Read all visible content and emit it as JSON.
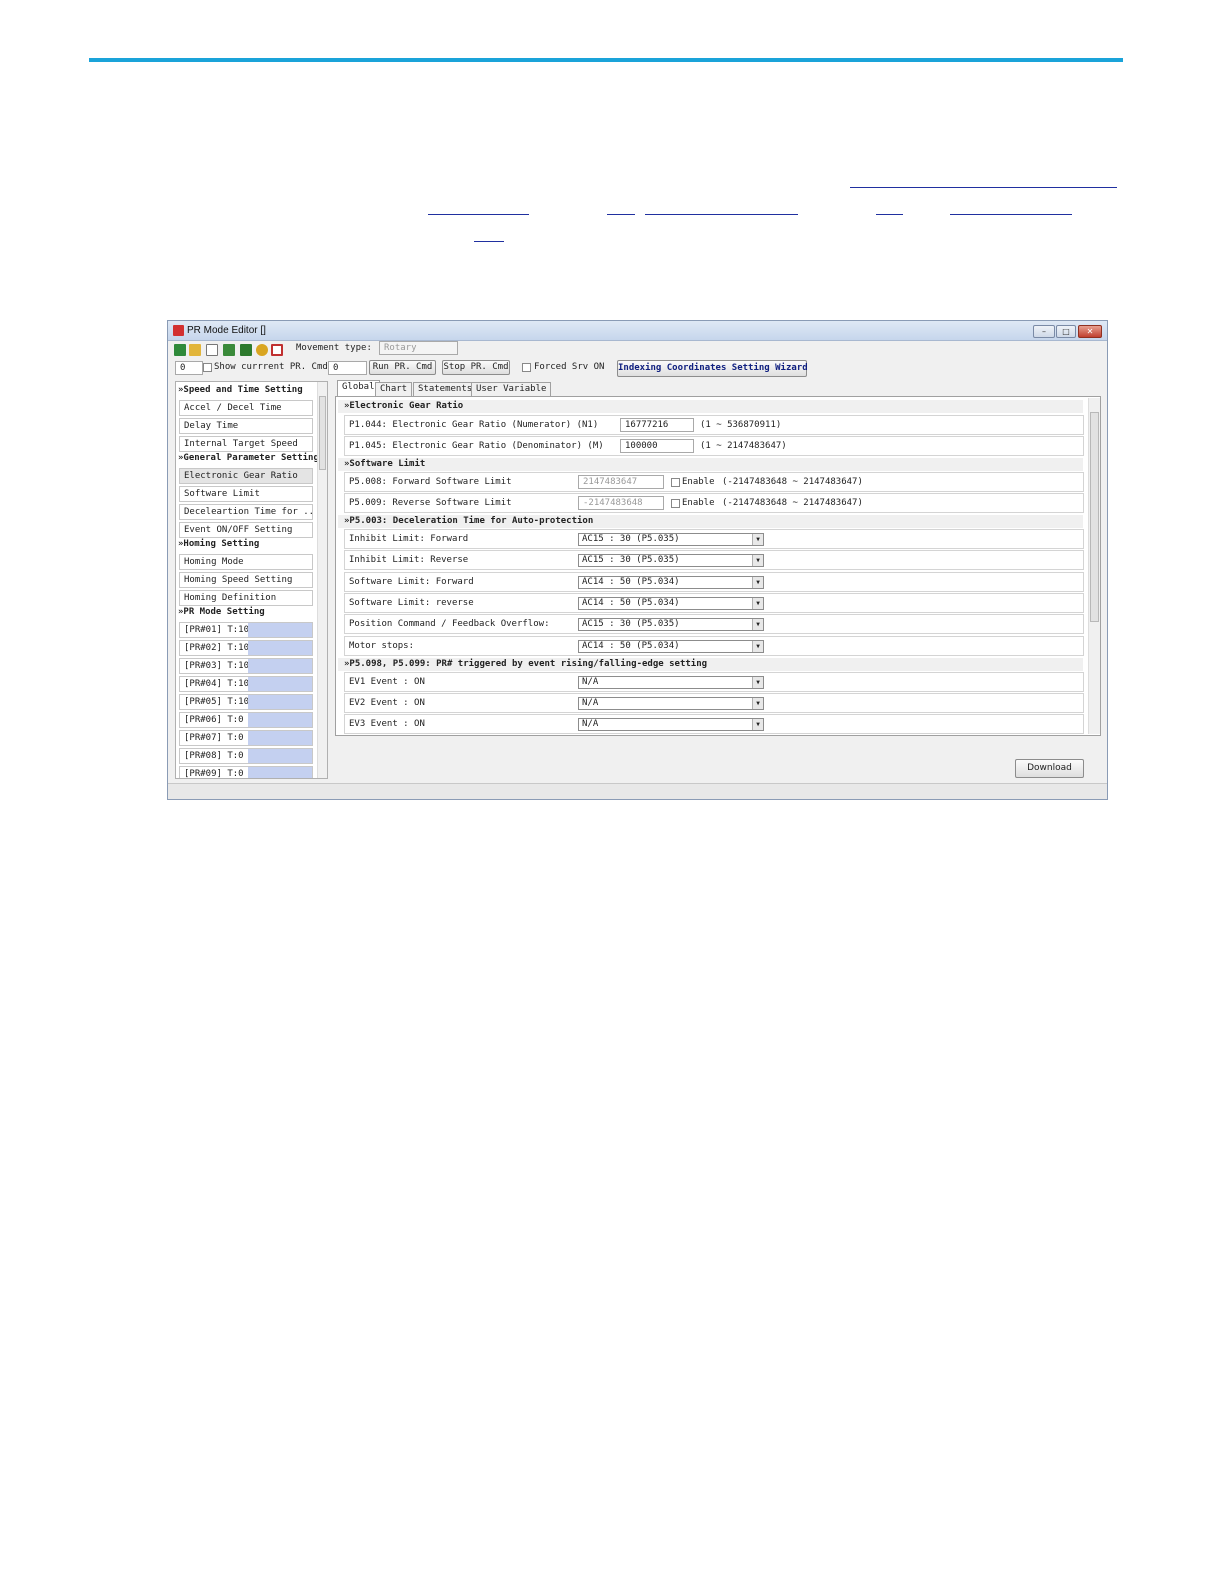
{
  "window": {
    "title": "PR Mode Editor []",
    "minimize": "–",
    "maximize": "□",
    "close": "✕"
  },
  "toolbar": {
    "icons": [
      "save-icon",
      "open-folder-icon",
      "new-document-icon",
      "import-icon",
      "export-icon",
      "key-icon",
      "settings-clear-icon"
    ],
    "movement_type_label": "Movement type:",
    "movement_type_value": "Rotary"
  },
  "toolbar2": {
    "pr_index": "0",
    "show_current_label": "Show currrent PR. Cmd",
    "pr_cmd_value": "0",
    "run_button": "Run PR. Cmd",
    "stop_button": "Stop PR. Cmd",
    "forced_srv_label": "Forced Srv ON",
    "wizard_button": "Indexing Coordinates Setting Wizard"
  },
  "sidebar": {
    "groups": [
      {
        "title": "Speed and Time Setting",
        "items": [
          "Accel / Decel Time",
          "Delay Time",
          "Internal Target Speed"
        ]
      },
      {
        "title": "General Parameter Setting",
        "items": [
          "Electronic Gear Ratio",
          "Software Limit",
          "Deceleartion Time for ...",
          "Event ON/OFF Setting"
        ]
      },
      {
        "title": "Homing Setting",
        "items": [
          "Homing Mode",
          "Homing Speed Setting",
          "Homing Definition"
        ]
      },
      {
        "title": "PR Mode Setting",
        "items": [
          "[PR#01] T:10",
          "[PR#02] T:10",
          "[PR#03] T:10",
          "[PR#04] T:10",
          "[PR#05] T:10",
          "[PR#06] T:0",
          "[PR#07] T:0",
          "[PR#08] T:0",
          "[PR#09] T:0"
        ]
      }
    ],
    "chevron": "»"
  },
  "tabs": [
    "Global",
    "Chart",
    "Statements",
    "User Variable"
  ],
  "global": {
    "gear_section": "Electronic Gear Ratio",
    "p1044_label": "P1.044: Electronic Gear Ratio (Numerator) (N1)",
    "p1044_value": "16777216",
    "p1044_range": "(1 ~ 536870911)",
    "p1045_label": "P1.045: Electronic Gear Ratio (Denominator) (M)",
    "p1045_value": "100000",
    "p1045_range": "(1 ~ 2147483647)",
    "swlimit_section": "Software Limit",
    "p5008_label": "P5.008: Forward Software Limit",
    "p5008_value": "2147483647",
    "p5009_label": "P5.009: Reverse Software Limit",
    "p5009_value": "-2147483648",
    "enable_label": "Enable",
    "sw_range": "(-2147483648 ~ 2147483647)",
    "decel_section": "P5.003: Deceleration Time for Auto-protection",
    "decel_rows": [
      {
        "label": "Inhibit Limit: Forward",
        "value": "AC15 : 30 (P5.035)"
      },
      {
        "label": "Inhibit Limit: Reverse",
        "value": "AC15 : 30 (P5.035)"
      },
      {
        "label": "Software Limit: Forward",
        "value": "AC14 : 50 (P5.034)"
      },
      {
        "label": "Software Limit: reverse",
        "value": "AC14 : 50 (P5.034)"
      },
      {
        "label": "Position Command / Feedback Overflow:",
        "value": "AC15 : 30 (P5.035)"
      },
      {
        "label": "Motor stops:",
        "value": "AC14 : 50 (P5.034)"
      }
    ],
    "event_section": "P5.098, P5.099: PR# triggered by event rising/falling-edge setting",
    "event_rows": [
      {
        "label": "EV1 Event : ON",
        "value": "N/A"
      },
      {
        "label": "EV2 Event : ON",
        "value": "N/A"
      },
      {
        "label": "EV3 Event : ON",
        "value": "N/A"
      }
    ]
  },
  "download_button": "Download"
}
